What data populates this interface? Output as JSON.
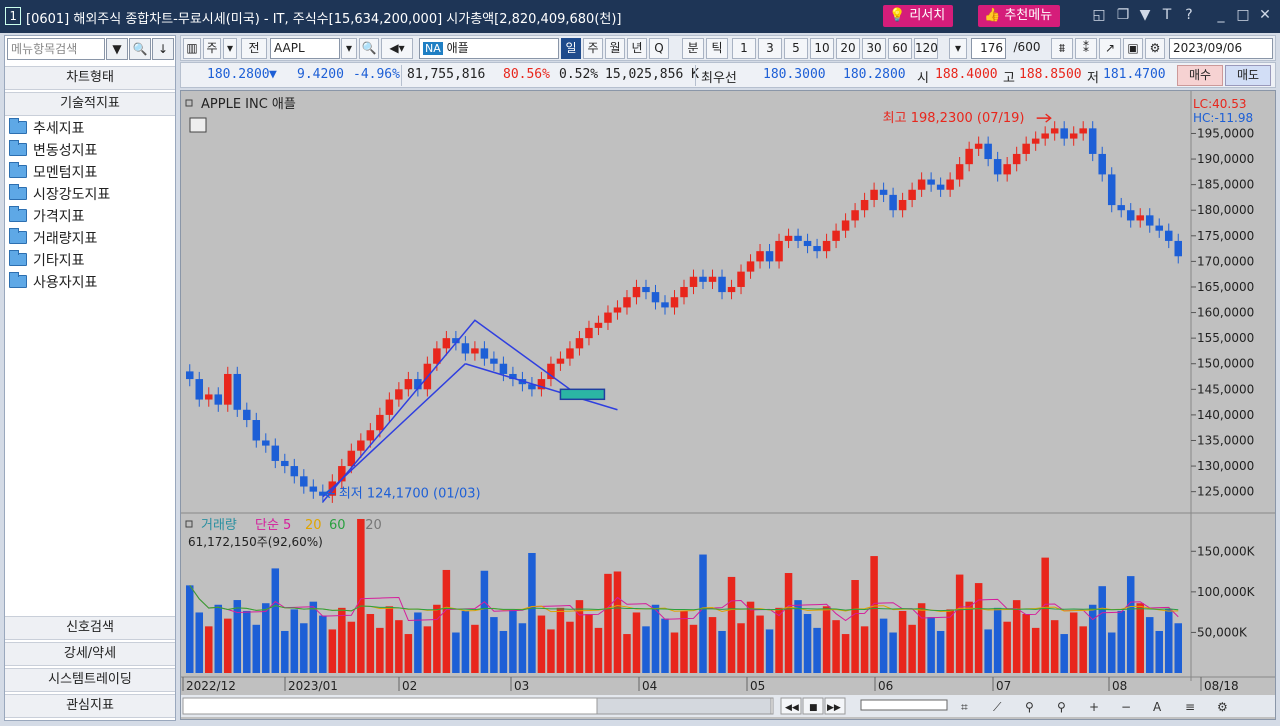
{
  "titlebar": {
    "window_num": "1",
    "title": "[0601] 해외주식 종합차트-무료시세(미국) - IT, 주식수[15,634,200,000] 시가총액[2,820,409,680(천)]",
    "research_btn": "리서치",
    "recommend_btn": "추천메뉴",
    "icons": [
      "screen-icon",
      "window-icon",
      "pin-icon",
      "font-icon",
      "help-icon",
      "minimize-icon",
      "maximize-icon",
      "close-icon"
    ]
  },
  "sidebar": {
    "search_placeholder": "메뉴항목검색",
    "headers": {
      "chart_type": "차트형태",
      "tech_indicators": "기술적지표",
      "signal_search": "신호검색",
      "strong_weak": "강세/약세",
      "system_trading": "시스템트레이딩",
      "watch_indicators": "관심지표"
    },
    "items": [
      "추세지표",
      "변동성지표",
      "모멘텀지표",
      "시장강도지표",
      "가격지표",
      "거래량지표",
      "기타지표",
      "사용자지표"
    ]
  },
  "toolbar": {
    "ju": "주",
    "jeon": "전",
    "symbol": "AAPL",
    "na_badge": "NA",
    "stock_name": "애플",
    "periods": [
      "일",
      "주",
      "월",
      "년",
      "Q"
    ],
    "bun": "분",
    "tik": "틱",
    "intervals": [
      "1",
      "3",
      "5",
      "10",
      "20",
      "30",
      "60",
      "120"
    ],
    "count": "176",
    "count_max": "/600",
    "date": "2023/09/06"
  },
  "quote": {
    "price": "180.2800",
    "arrow": "▼",
    "change": "9.4200",
    "change_pct": "-4.96%",
    "volume": "81,755,816",
    "vol_pct": "80.56%",
    "turnover": "0.52%",
    "prev_vol": "15,025,856 K",
    "best_label": "최우선",
    "best_bid": "180.3000",
    "best_ask": "180.2800",
    "open_label": "시",
    "open": "188.4000",
    "high_label": "고",
    "high": "188.8500",
    "low_label": "저",
    "low": "181.4700",
    "buy": "매수",
    "sell": "매도"
  },
  "chart": {
    "title": "APPLE INC  애플",
    "lc": "LC:40.53",
    "hc": "HC:-11.98",
    "high_label": "최고 198,2300 (07/19)",
    "low_label": "최저 124,1700 (01/03)",
    "y_ticks": [
      "195,0000",
      "190,0000",
      "185,0000",
      "180,0000",
      "175,0000",
      "170,0000",
      "165,0000",
      "160,0000",
      "155,0000",
      "150,0000",
      "145,0000",
      "140,0000",
      "135,0000",
      "130,0000",
      "125,0000"
    ],
    "vol_legend": {
      "vol": "거래량",
      "simple": "단순 5",
      "ma20": "20",
      "ma60": "60",
      "ma120": "120"
    },
    "vol_value": "61,172,150주(92,60%)",
    "vol_ticks": [
      "150,000K",
      "100,000K",
      "50,000K"
    ],
    "x_ticks": [
      "2022/12",
      "2023/01",
      "02",
      "03",
      "04",
      "05",
      "06",
      "07",
      "08",
      "08/18"
    ]
  },
  "colors": {
    "up": "#e8261c",
    "down": "#1d5fd6",
    "chart_bg": "#c0c0c0",
    "accent": "#d51d7a"
  },
  "chart_data": {
    "type": "candlestick",
    "title": "APPLE INC 애플",
    "x_range": [
      "2022/12",
      "2023/09/06"
    ],
    "ylim": [
      122,
      199
    ],
    "price_axis_ticks": [
      195,
      190,
      185,
      180,
      175,
      170,
      165,
      160,
      155,
      150,
      145,
      140,
      135,
      130,
      125
    ],
    "closes": [
      147,
      143,
      144,
      142,
      148,
      141,
      139,
      135,
      134,
      131,
      130,
      128,
      126,
      125,
      124.2,
      127,
      130,
      133,
      135,
      137,
      140,
      143,
      145,
      147,
      145,
      150,
      153,
      155,
      154,
      152,
      153,
      151,
      150,
      148,
      147,
      146,
      145,
      147,
      150,
      151,
      153,
      155,
      157,
      158,
      160,
      161,
      163,
      165,
      164,
      162,
      161,
      163,
      165,
      167,
      166,
      167,
      164,
      165,
      168,
      170,
      172,
      170,
      174,
      175,
      174,
      173,
      172,
      174,
      176,
      178,
      180,
      182,
      184,
      183,
      180,
      182,
      184,
      186,
      185,
      184,
      186,
      189,
      192,
      193,
      190,
      187,
      189,
      191,
      193,
      194,
      195,
      196,
      194,
      195,
      196,
      191,
      187,
      181,
      180,
      178,
      179,
      177,
      176,
      174,
      171
    ],
    "volume_ticks_k": [
      150000,
      100000,
      50000
    ],
    "volume_last": "61,172,150",
    "volume_last_pct": "92.60%",
    "high": {
      "value": 198.23,
      "date": "07/19"
    },
    "low": {
      "value": 124.17,
      "date": "01/03"
    },
    "ma_series": [
      "단순 5",
      "20",
      "60",
      "120"
    ]
  }
}
